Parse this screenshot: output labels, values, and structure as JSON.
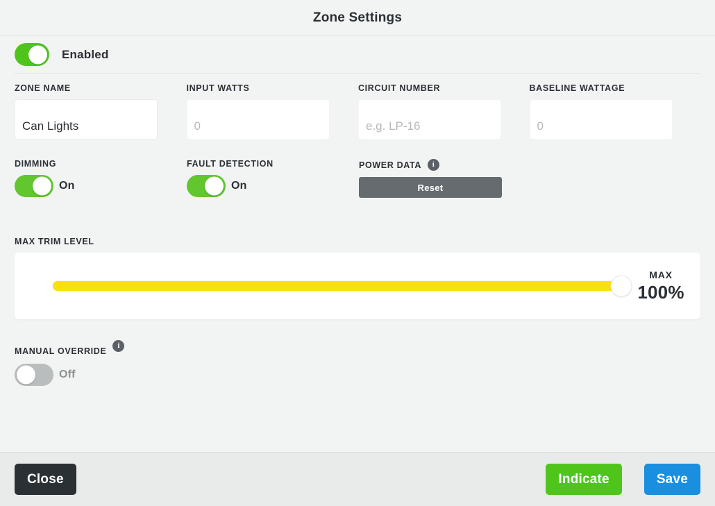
{
  "header": {
    "title": "Zone Settings"
  },
  "enabled": {
    "label": "Enabled",
    "state": "on",
    "color": "#4fc51c"
  },
  "fields": [
    {
      "label": "ZONE NAME",
      "value": "Can Lights",
      "placeholder": "",
      "bordered": true
    },
    {
      "label": "INPUT WATTS",
      "value": "",
      "placeholder": "0",
      "bordered": false
    },
    {
      "label": "CIRCUIT NUMBER",
      "value": "",
      "placeholder": "e.g. LP-16",
      "bordered": false
    },
    {
      "label": "BASELINE WATTAGE",
      "value": "",
      "placeholder": "0",
      "bordered": false
    }
  ],
  "dimming": {
    "label": "DIMMING",
    "state_label": "On",
    "state": "on"
  },
  "fault_detection": {
    "label": "FAULT DETECTION",
    "state_label": "On",
    "state": "on"
  },
  "power_data": {
    "label": "POWER DATA",
    "info_icon": "info-icon",
    "info_glyph": "i",
    "reset_label": "Reset",
    "reset_color": "#666b70"
  },
  "max_trim": {
    "label": "MAX TRIM LEVEL",
    "max_word": "MAX",
    "value_label": "100%",
    "value_percent": 100,
    "track_color": "#fbe10c"
  },
  "manual_override": {
    "label": "MANUAL OVERRIDE",
    "info_glyph": "i",
    "state_label": "Off",
    "state": "off"
  },
  "footer": {
    "close_label": "Close",
    "indicate_label": "Indicate",
    "save_label": "Save",
    "close_color": "#2b3035",
    "indicate_color": "#4fc51c",
    "save_color": "#1a8fe0"
  }
}
